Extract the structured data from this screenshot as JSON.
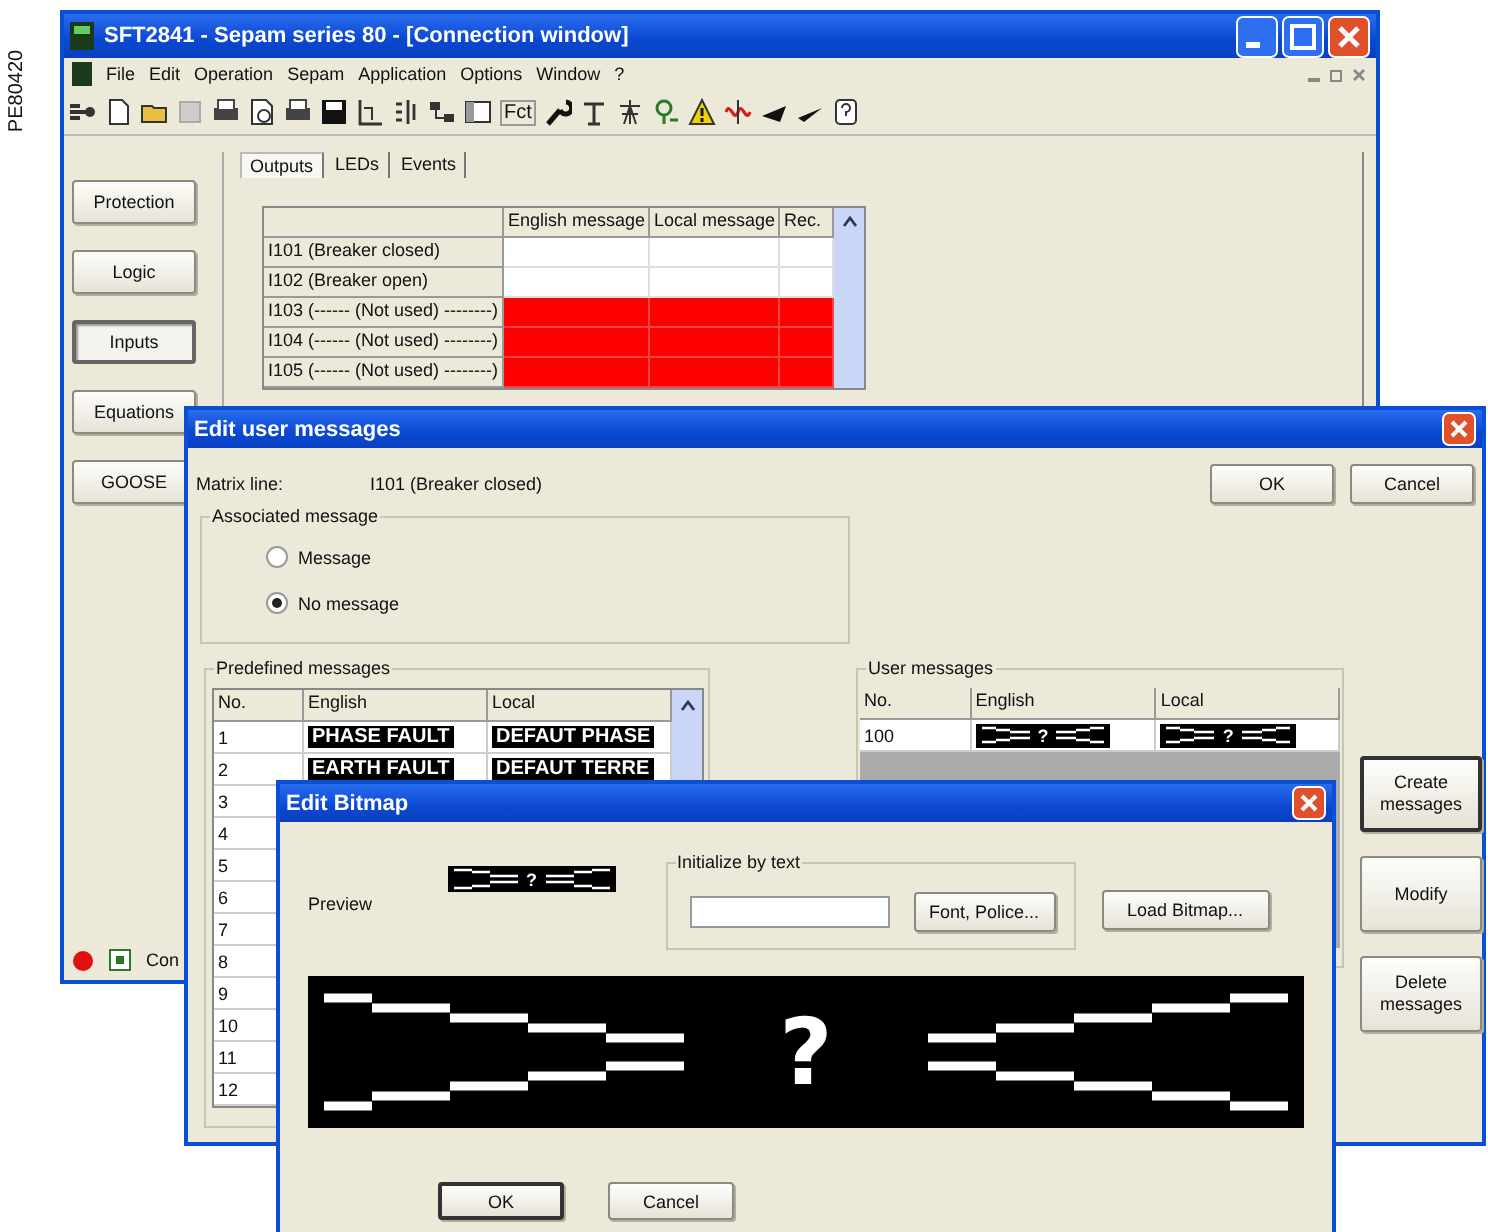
{
  "figure_label": "PE80420",
  "main_window": {
    "title": "SFT2841 - Sepam series 80 - [Connection window]",
    "menu": [
      "File",
      "Edit",
      "Operation",
      "Sepam",
      "Application",
      "Options",
      "Window",
      "?"
    ],
    "toolbar_text": "Fct",
    "side_buttons": [
      {
        "label": "Protection",
        "selected": false
      },
      {
        "label": "Logic",
        "selected": false
      },
      {
        "label": "Inputs",
        "selected": true
      },
      {
        "label": "Equations",
        "selected": false
      },
      {
        "label": "GOOSE",
        "selected": false
      }
    ],
    "tabs": [
      {
        "label": "Outputs",
        "selected": true
      },
      {
        "label": "LEDs",
        "selected": false
      },
      {
        "label": "Events",
        "selected": false
      }
    ],
    "table": {
      "columns": [
        "English message",
        "Local message",
        "Rec."
      ],
      "rows": [
        {
          "label": "I101 (Breaker closed)",
          "used": true
        },
        {
          "label": "I102 (Breaker open)",
          "used": true
        },
        {
          "label": "I103 (------ (Not used) --------)",
          "used": false
        },
        {
          "label": "I104 (------ (Not used) --------)",
          "used": false
        },
        {
          "label": "I105 (------ (Not used) --------)",
          "used": false
        }
      ]
    },
    "status_text": "Con"
  },
  "user_messages_dialog": {
    "title": "Edit user messages",
    "matrix_line_label": "Matrix line:",
    "matrix_line_value": "I101 (Breaker closed)",
    "ok": "OK",
    "cancel": "Cancel",
    "associated_title": "Associated message",
    "radios": [
      {
        "label": "Message",
        "selected": false
      },
      {
        "label": "No message",
        "selected": true
      }
    ],
    "predefined_title": "Predefined messages",
    "predefined_columns": [
      "No.",
      "English",
      "Local"
    ],
    "predefined_rows": [
      {
        "no": "1",
        "english": "PHASE FAULT",
        "local": "DEFAUT PHASE"
      },
      {
        "no": "2",
        "english": "EARTH FAULT",
        "local": "DEFAUT TERRE"
      },
      {
        "no": "3"
      },
      {
        "no": "4"
      },
      {
        "no": "5"
      },
      {
        "no": "6"
      },
      {
        "no": "7"
      },
      {
        "no": "8"
      },
      {
        "no": "9"
      },
      {
        "no": "10"
      },
      {
        "no": "11"
      },
      {
        "no": "12"
      }
    ],
    "user_title": "User messages",
    "user_columns": [
      "No.",
      "English",
      "Local"
    ],
    "user_rows": [
      {
        "no": "100",
        "english": "?",
        "local": "?"
      }
    ],
    "side_buttons": [
      "Create messages",
      "Modify",
      "Delete messages"
    ]
  },
  "bitmap_dialog": {
    "title": "Edit Bitmap",
    "preview_label": "Preview",
    "preview_text": "?",
    "init_title": "Initialize by text",
    "font_button": "Font, Police...",
    "load_button": "Load Bitmap...",
    "bitmap_text": "?",
    "ok": "OK",
    "cancel": "Cancel"
  }
}
